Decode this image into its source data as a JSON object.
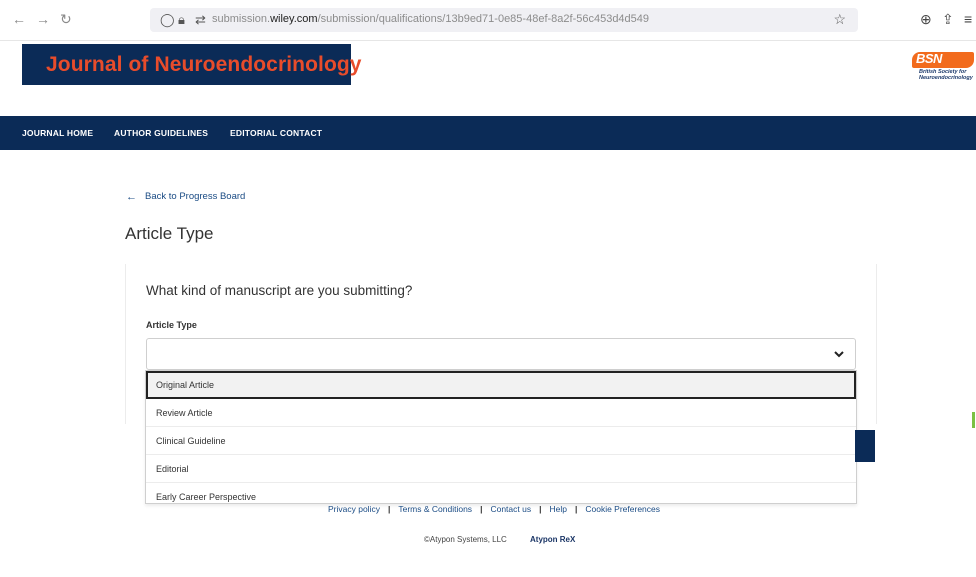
{
  "browser": {
    "url_prefix": "submission.",
    "url_domain": "wiley.com",
    "url_path": "/submission/qualifications/13b9ed71-0e85-48ef-8a2f-56c453d4d549"
  },
  "header": {
    "journal_title": "Journal of Neuroendocrinology",
    "society_logo_letters": "BSN",
    "society_logo_text": "British Society for Neuroendocrinology"
  },
  "nav": {
    "items": [
      {
        "label": "JOURNAL HOME"
      },
      {
        "label": "AUTHOR GUIDELINES"
      },
      {
        "label": "EDITORIAL CONTACT"
      }
    ]
  },
  "main": {
    "back_link": "Back to Progress Board",
    "page_title": "Article Type",
    "question": "What kind of manuscript are you submitting?",
    "field_label": "Article Type",
    "select_value": "",
    "options": [
      {
        "label": "Original Article"
      },
      {
        "label": "Review Article"
      },
      {
        "label": "Clinical Guideline"
      },
      {
        "label": "Editorial"
      },
      {
        "label": "Early Career Perspective"
      }
    ]
  },
  "footer": {
    "links": [
      {
        "label": "Privacy policy"
      },
      {
        "label": "Terms & Conditions"
      },
      {
        "label": "Contact us"
      },
      {
        "label": "Help"
      },
      {
        "label": "Cookie Preferences"
      }
    ],
    "copyright": "©Atypon Systems, LLC",
    "brand": "Atypon ReX"
  },
  "colors": {
    "brand_navy": "#0b2b57",
    "title_orange": "#e84c2b",
    "link_blue": "#1a4b84"
  }
}
